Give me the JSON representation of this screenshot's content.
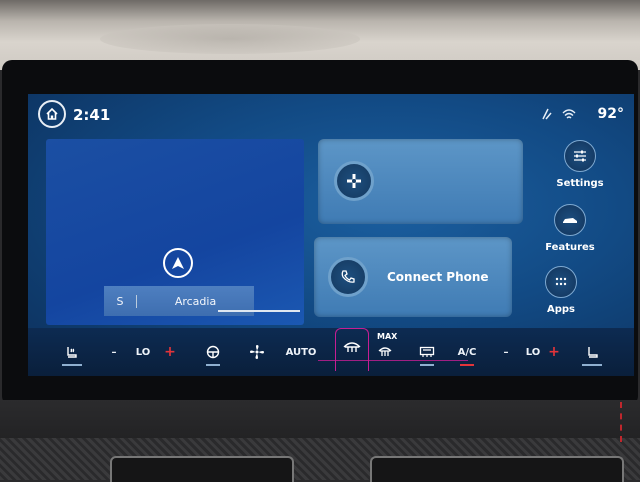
{
  "status": {
    "time": "2:41",
    "temperature": "92°",
    "icons": [
      "signal-icon",
      "wifi-icon"
    ]
  },
  "map": {
    "direction": "S",
    "street": "Arcadia"
  },
  "tiles": {
    "media_label": "",
    "phone_label": "Connect Phone"
  },
  "sidebar": {
    "items": [
      {
        "label": "Settings",
        "icon": "sliders-icon"
      },
      {
        "label": "Features",
        "icon": "car-icon"
      },
      {
        "label": "Apps",
        "icon": "apps-grid-icon"
      }
    ]
  },
  "climate": {
    "left_minus": "–",
    "left_temp": "LO",
    "left_plus": "+",
    "auto": "AUTO",
    "max": "MAX",
    "ac": "A/C",
    "right_minus": "–",
    "right_temp": "LO",
    "right_plus": "+"
  },
  "colors": {
    "accent_red": "#e2343a",
    "accent_magenta": "#c61e93",
    "screen_blue": "#124a84"
  }
}
